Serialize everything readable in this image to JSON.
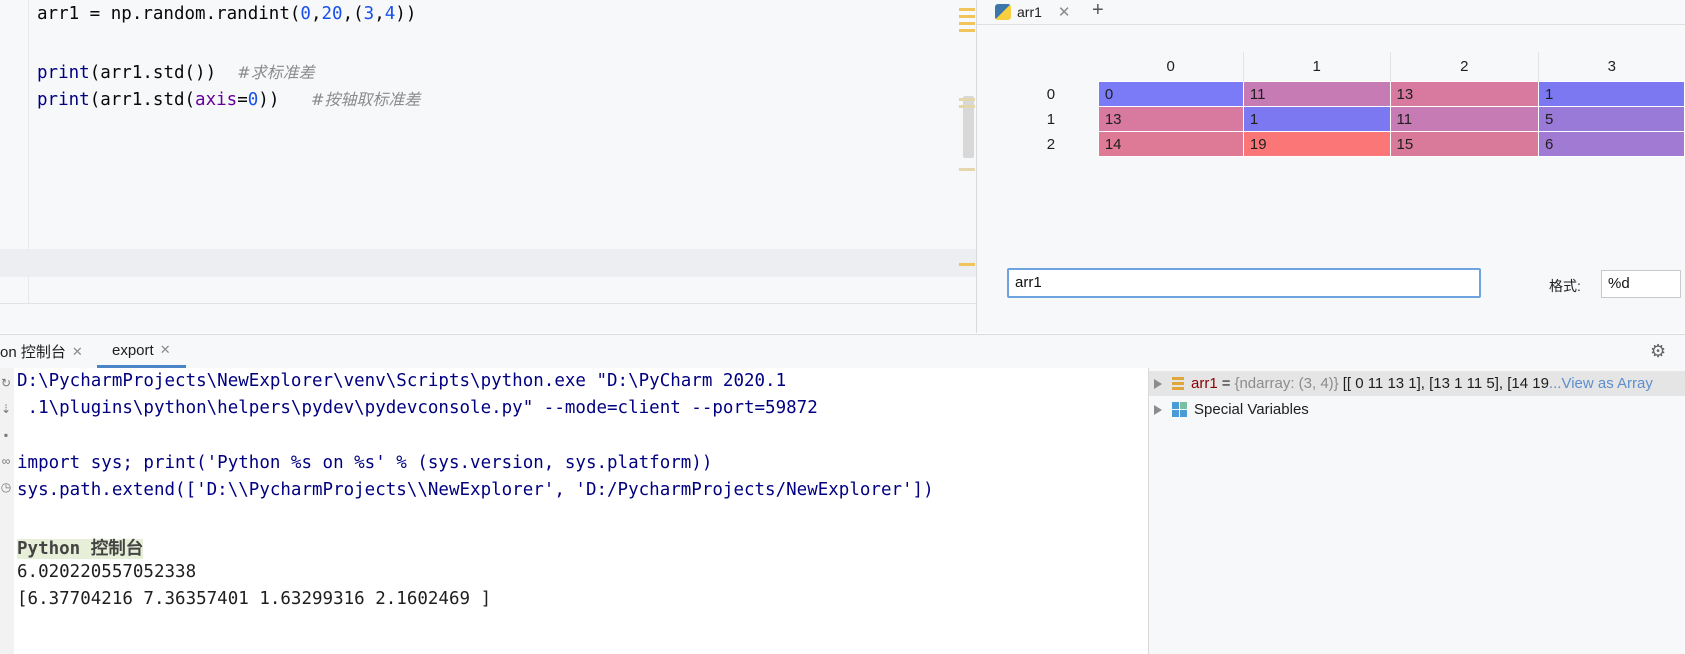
{
  "editor": {
    "lines": [
      {
        "t1": "arr1 = np.random.randint(",
        "n1": "0",
        "c1": ",",
        "n2": "20",
        "c2": ",(",
        "n3": "3",
        "c3": ",",
        "n4": "4",
        "c4": "))"
      },
      {
        "fn": "print",
        "body": "(arr1.std())  ",
        "comment": "#求标准差"
      },
      {
        "fn": "print",
        "body_a": "(arr1.std(",
        "kw": "axis",
        "eq": "=",
        "num": "0",
        "body_b": "))   ",
        "comment": "#按轴取标准差"
      }
    ]
  },
  "viewer": {
    "tab_label": "arr1",
    "column_headers": [
      "0",
      "1",
      "2",
      "3"
    ],
    "rows": [
      {
        "label": "0",
        "cells": [
          "0",
          "11",
          "13",
          "1"
        ],
        "colors": [
          "#7b7bf7",
          "#c77bb5",
          "#d87a9f",
          "#7b78f2"
        ]
      },
      {
        "label": "1",
        "cells": [
          "13",
          "1",
          "11",
          "5"
        ],
        "colors": [
          "#d87a9f",
          "#7b78f2",
          "#c77bb5",
          "#9a7ad8"
        ]
      },
      {
        "label": "2",
        "cells": [
          "14",
          "19",
          "15",
          "6"
        ],
        "colors": [
          "#de7a96",
          "#fb7777",
          "#d97a9b",
          "#a17ad3"
        ]
      }
    ],
    "expression_value": "arr1",
    "format_label": "格式:",
    "format_value": "%d"
  },
  "console_tabs": {
    "tab1": "on 控制台",
    "tab2": "export"
  },
  "console": {
    "cmd_lines": [
      "D:\\PycharmProjects\\NewExplorer\\venv\\Scripts\\python.exe \"D:\\PyCharm 2020.1",
      " .1\\plugins\\python\\helpers\\pydev\\pydevconsole.py\" --mode=client --port=59872",
      "",
      "import sys; print('Python %s on %s' % (sys.version, sys.platform))",
      "sys.path.extend(['D:\\\\PycharmProjects\\\\NewExplorer', 'D:/PycharmProjects/NewExplorer'])"
    ],
    "banner": "Python 控制台",
    "out1": "6.020220557052338",
    "out2": "[6.37704216 7.36357401 1.63299316 2.1602469 ]"
  },
  "variables": {
    "arr1_name": "arr1",
    "arr1_eq": "=",
    "arr1_type": "{ndarray: (3, 4)}",
    "arr1_value": "[[ 0 11 13  1], [13  1 11  5], [14 19",
    "arr1_link": "...View as Array",
    "special": "Special Variables"
  }
}
